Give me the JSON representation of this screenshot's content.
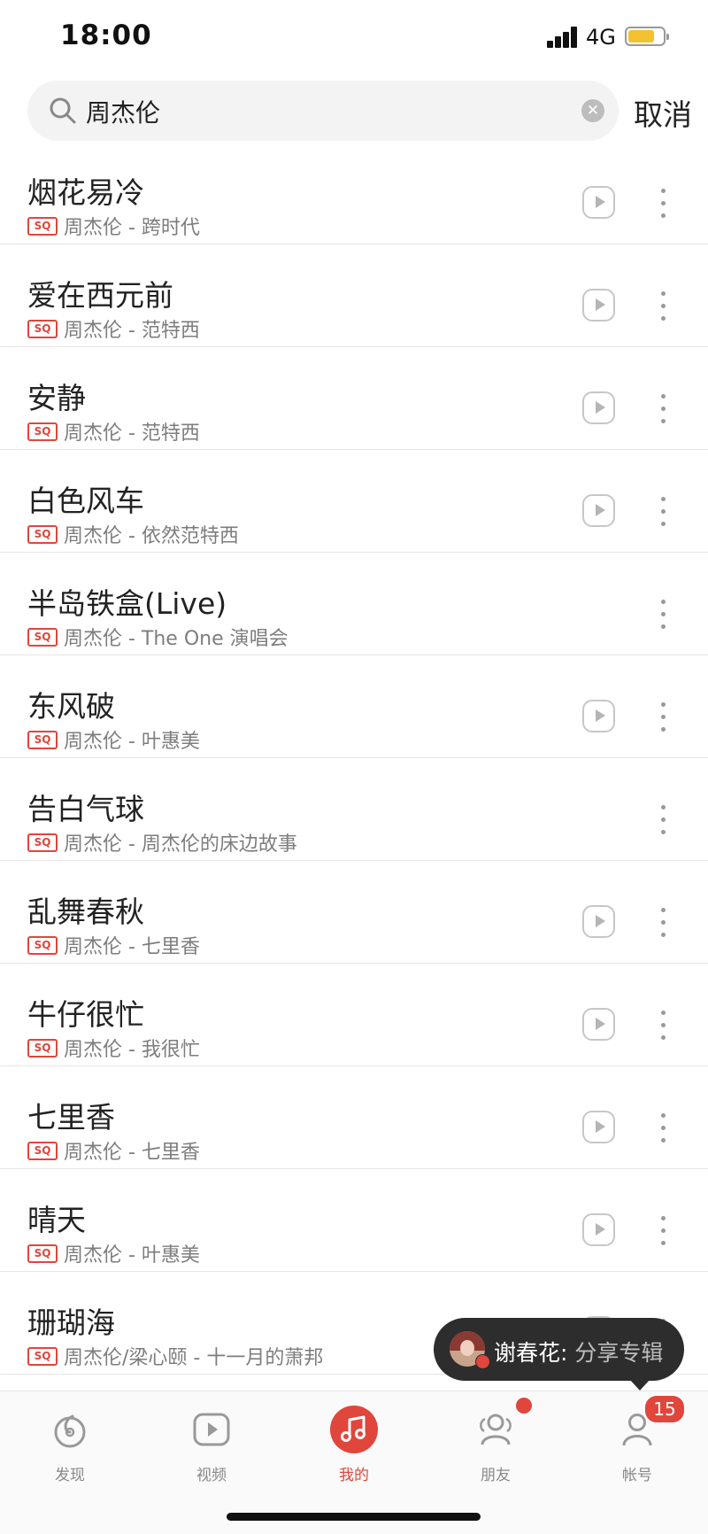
{
  "status_bar": {
    "time": "18:00",
    "network": "4G"
  },
  "search": {
    "query": "周杰伦",
    "cancel_label": "取消"
  },
  "quality_tag": "SQ",
  "songs": [
    {
      "title": "烟花易冷",
      "meta": "周杰伦 - 跨时代",
      "has_play": true
    },
    {
      "title": "爱在西元前",
      "meta": "周杰伦 - 范特西",
      "has_play": true
    },
    {
      "title": "安静",
      "meta": "周杰伦 - 范特西",
      "has_play": true
    },
    {
      "title": "白色风车",
      "meta": "周杰伦 - 依然范特西",
      "has_play": true
    },
    {
      "title": "半岛铁盒(Live)",
      "meta": "周杰伦 - The One 演唱会",
      "has_play": false
    },
    {
      "title": "东风破",
      "meta": "周杰伦 - 叶惠美",
      "has_play": true
    },
    {
      "title": "告白气球",
      "meta": "周杰伦 - 周杰伦的床边故事",
      "has_play": false
    },
    {
      "title": "乱舞春秋",
      "meta": "周杰伦 - 七里香",
      "has_play": true
    },
    {
      "title": "牛仔很忙",
      "meta": "周杰伦 - 我很忙",
      "has_play": true
    },
    {
      "title": "七里香",
      "meta": "周杰伦 - 七里香",
      "has_play": true
    },
    {
      "title": "晴天",
      "meta": "周杰伦 - 叶惠美",
      "has_play": true
    },
    {
      "title": "珊瑚海",
      "meta": "周杰伦/梁心颐 - 十一月的萧邦",
      "has_play": true
    }
  ],
  "toast": {
    "user": "谢春花:",
    "action": " 分享专辑"
  },
  "tabs": [
    {
      "label": "发现",
      "icon": "discover-icon",
      "active": false
    },
    {
      "label": "视频",
      "icon": "video-icon",
      "active": false
    },
    {
      "label": "我的",
      "icon": "music-note-icon",
      "active": true
    },
    {
      "label": "朋友",
      "icon": "friends-icon",
      "active": false
    },
    {
      "label": "帐号",
      "icon": "account-icon",
      "active": false
    }
  ],
  "account_badge": "15",
  "colors": {
    "accent": "#e0463c",
    "battery": "#f2c230",
    "toast_bg": "#2d2d2d"
  }
}
